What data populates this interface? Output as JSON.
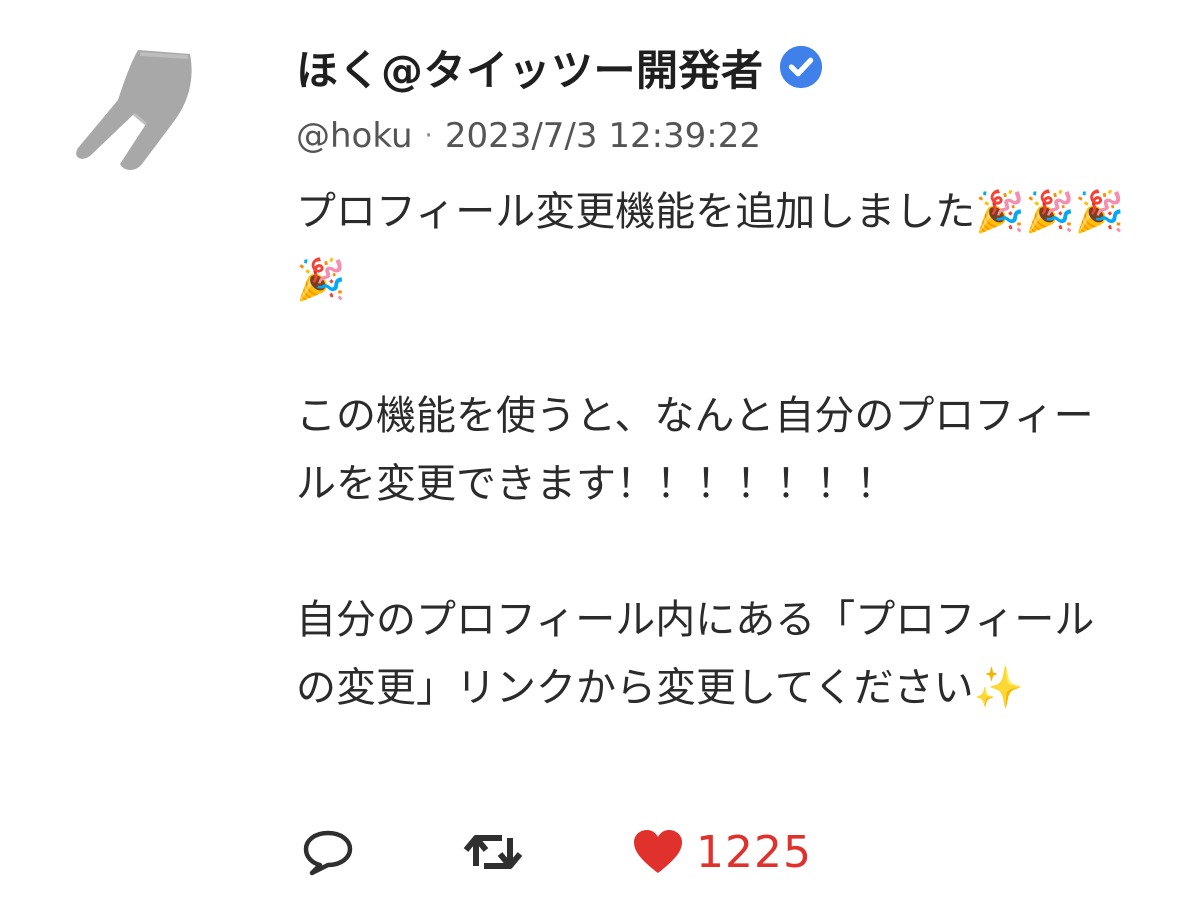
{
  "tweet": {
    "display_name": "ほく@タイッツー開発者",
    "handle": "@hoku",
    "separator": "·",
    "timestamp": "2023/7/3 12:39:22",
    "text": "プロフィール変更機能を追加しました🎉🎉🎉🎉\n\nこの機能を使うと、なんと自分のプロフィールを変更できます！！！！！！！\n\n自分のプロフィール内にある「プロフィールの変更」リンクから変更してください✨",
    "verified": true
  },
  "avatar": {
    "icon": "tights-icon",
    "color": "#a8a8a8"
  },
  "actions": {
    "reply_icon": "reply-bubble-icon",
    "retweet_icon": "retweet-icon",
    "like_icon": "heart-icon",
    "like_count": "1225"
  },
  "colors": {
    "verified": "#3f80ea",
    "like": "#e0312d",
    "text": "#2b2b2b",
    "meta": "#555555"
  }
}
